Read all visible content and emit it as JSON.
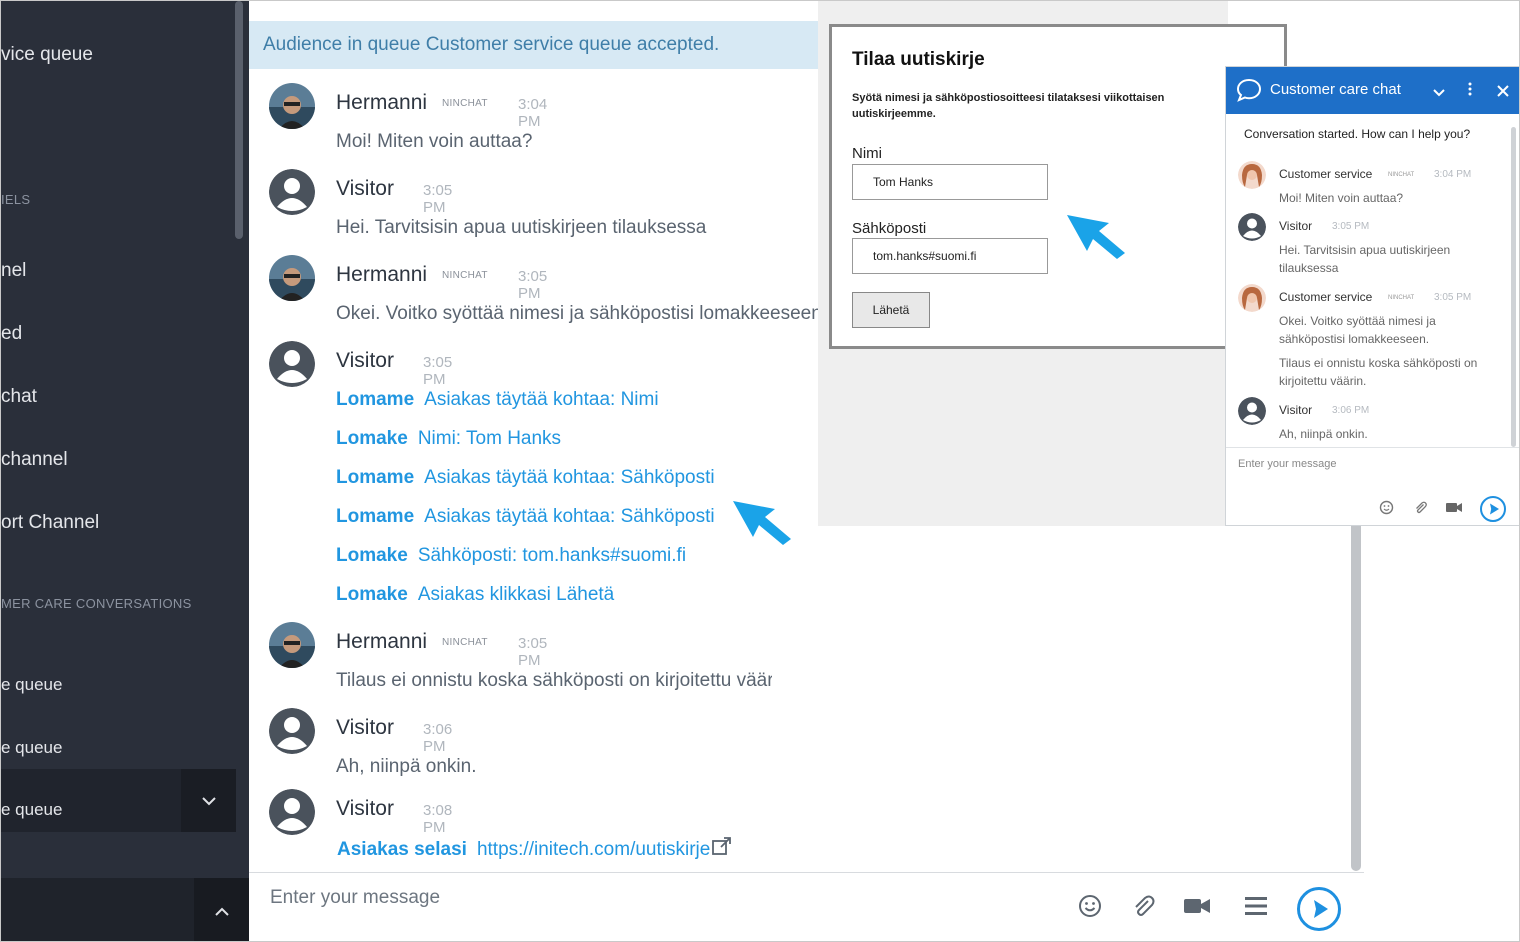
{
  "sidebar": {
    "items": [
      {
        "label": "vice queue"
      },
      {
        "label": "IELS"
      },
      {
        "label": "nel"
      },
      {
        "label": "ed"
      },
      {
        "label": "chat"
      },
      {
        "label": "channel"
      },
      {
        "label": "ort Channel"
      },
      {
        "label": "MER CARE CONVERSATIONS"
      },
      {
        "label": "e queue"
      },
      {
        "label": "e queue"
      },
      {
        "label": "e queue"
      }
    ]
  },
  "banner": "Audience in queue Customer service queue accepted.",
  "messages": [
    {
      "sender": "Hermanni",
      "badge": "NINCHAT",
      "time": "3:04 PM",
      "text": "Moi! Miten voin auttaa?"
    },
    {
      "sender": "Visitor",
      "time": "3:05 PM",
      "text": "Hei. Tarvitsisin apua uutiskirjeen tilauksessa"
    },
    {
      "sender": "Hermanni",
      "badge": "NINCHAT",
      "time": "3:05 PM",
      "text": "Okei. Voitko syöttää nimesi ja sähköpostisi lomakkeeseen."
    },
    {
      "sender": "Visitor",
      "time": "3:05 PM",
      "events": [
        {
          "key": "Lomame",
          "val": "Asiakas täytää kohtaa: Nimi"
        },
        {
          "key": "Lomake",
          "val": "Nimi: Tom Hanks"
        },
        {
          "key": "Lomame",
          "val": "Asiakas täytää kohtaa: Sähköposti"
        },
        {
          "key": "Lomame",
          "val": "Asiakas täytää kohtaa: Sähköposti"
        },
        {
          "key": "Lomake",
          "val": "Sähköposti: tom.hanks#suomi.fi"
        },
        {
          "key": "Lomake",
          "val": "Asiakas klikkasi Lähetä"
        }
      ]
    },
    {
      "sender": "Hermanni",
      "badge": "NINCHAT",
      "time": "3:05 PM",
      "text": "Tilaus ei onnistu koska sähköposti on kirjoitettu väärin."
    },
    {
      "sender": "Visitor",
      "time": "3:06 PM",
      "text": "Ah, niinpä onkin."
    },
    {
      "sender": "Visitor",
      "time": "3:08 PM",
      "link_key": "Asiakas selasi",
      "link": "https://initech.com/uutiskirje"
    }
  ],
  "composer": {
    "placeholder": "Enter your message"
  },
  "form": {
    "title": "Tilaa uutiskirje",
    "description": "Syötä nimesi ja sähköpostiosoitteesi tilataksesi viikottaisen uutiskirjeemme.",
    "name_label": "Nimi",
    "name_value": "Tom Hanks",
    "email_label": "Sähköposti",
    "email_value": "tom.hanks#suomi.fi",
    "submit": "Lähetä"
  },
  "widget": {
    "title": "Customer care chat",
    "started": "Conversation started. How can I help you?",
    "messages": [
      {
        "sender": "Customer service",
        "badge": "NINCHAT",
        "time": "3:04 PM",
        "texts": [
          "Moi! Miten voin auttaa?"
        ]
      },
      {
        "sender": "Visitor",
        "time": "3:05 PM",
        "texts": [
          "Hei. Tarvitsisin apua uutiskirjeen tilauksessa"
        ]
      },
      {
        "sender": "Customer service",
        "badge": "NINCHAT",
        "time": "3:05 PM",
        "texts": [
          "Okei. Voitko syöttää nimesi ja sähköpostisi lomakkeeseen.",
          "Tilaus ei onnistu koska sähköposti on kirjoitettu väärin."
        ]
      },
      {
        "sender": "Visitor",
        "time": "3:06 PM",
        "texts": [
          "Ah, niinpä onkin."
        ]
      }
    ],
    "placeholder": "Enter your message"
  },
  "colors": {
    "accent": "#1e90e0",
    "sidebar": "#2a2f3a",
    "widget_header": "#1e6fc8"
  }
}
